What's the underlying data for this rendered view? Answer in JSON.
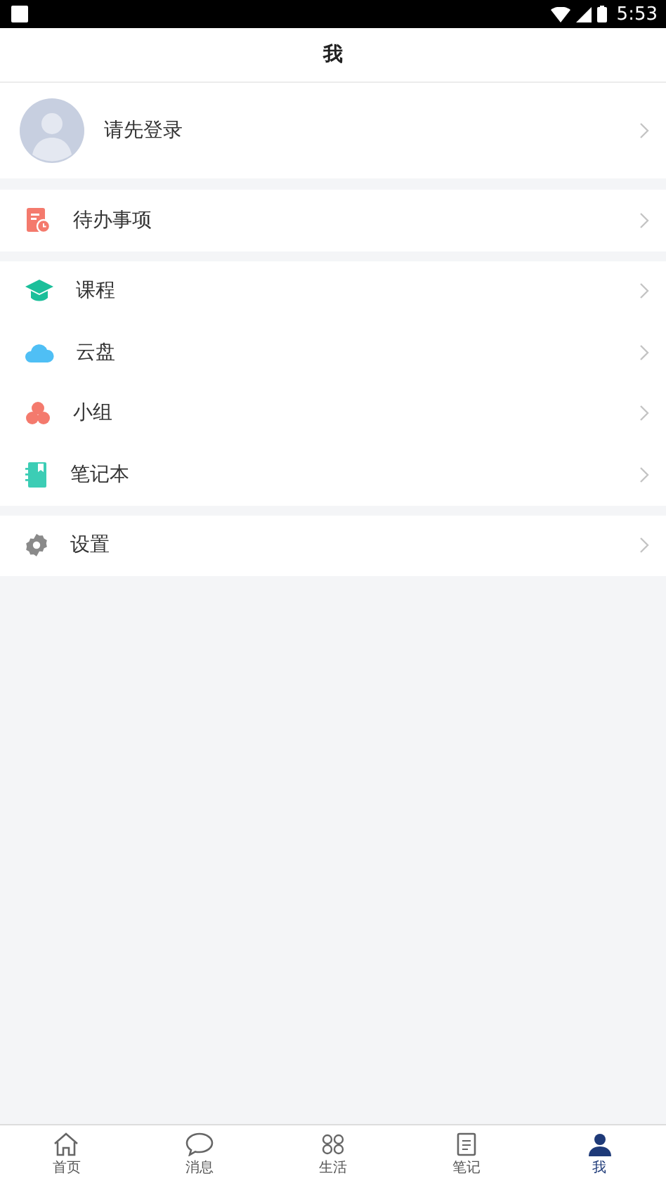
{
  "status_bar": {
    "time": "5:53"
  },
  "header": {
    "title": "我"
  },
  "profile": {
    "label": "请先登录"
  },
  "sections": [
    {
      "items": [
        {
          "kind": "todo",
          "label": "待办事项"
        }
      ]
    },
    {
      "items": [
        {
          "kind": "course",
          "label": "课程"
        },
        {
          "kind": "cloud",
          "label": "云盘"
        },
        {
          "kind": "group",
          "label": "小组"
        },
        {
          "kind": "notebook",
          "label": "笔记本"
        }
      ]
    },
    {
      "items": [
        {
          "kind": "settings",
          "label": "设置"
        }
      ]
    }
  ],
  "tab_bar": [
    {
      "kind": "home",
      "label": "首页",
      "selected": false
    },
    {
      "kind": "message",
      "label": "消息",
      "selected": false
    },
    {
      "kind": "life",
      "label": "生活",
      "selected": false
    },
    {
      "kind": "notes",
      "label": "笔记",
      "selected": false
    },
    {
      "kind": "me",
      "label": "我",
      "selected": true
    }
  ]
}
